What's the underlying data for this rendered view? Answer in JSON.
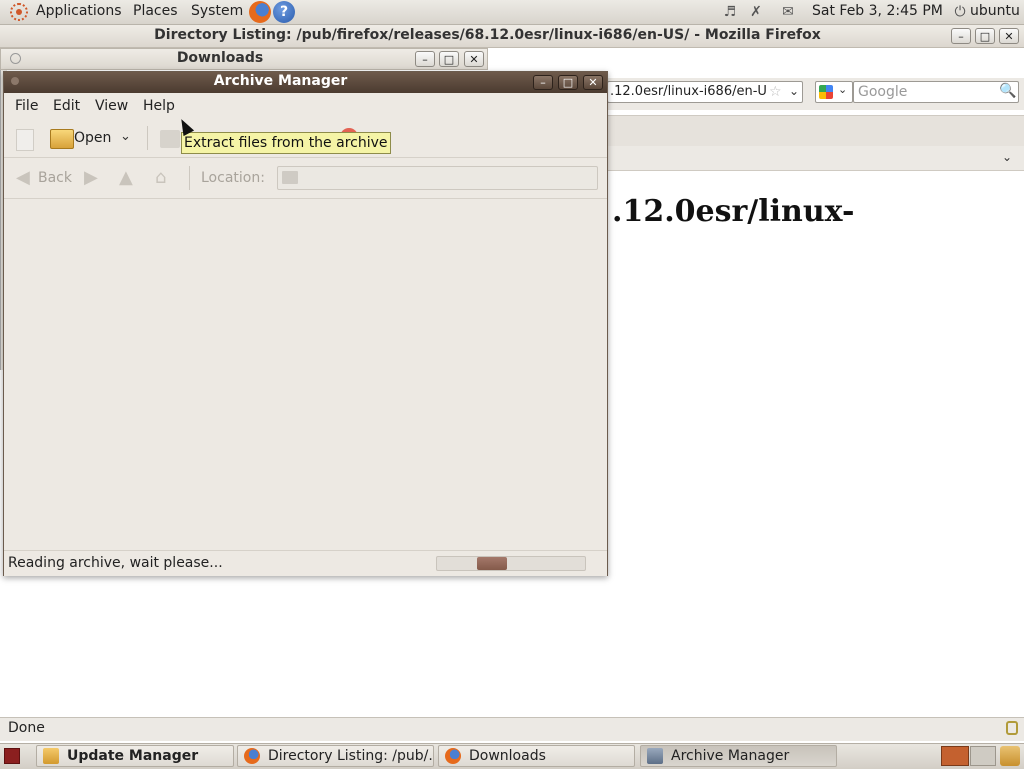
{
  "top_panel": {
    "applications": "Applications",
    "places": "Places",
    "system": "System",
    "datetime": "Sat Feb  3,  2:45 PM",
    "user": "ubuntu",
    "help_glyph": "?"
  },
  "firefox": {
    "title": "Directory Listing: /pub/firefox/releases/68.12.0esr/linux-i686/en-US/ - Mozilla Firefox",
    "url_visible": ".12.0esr/linux-i686/en-U",
    "search_placeholder": "Google",
    "heading_visible": ".12.0esr/linux-",
    "status": "Done"
  },
  "downloads": {
    "title": "Downloads"
  },
  "archive_manager": {
    "title": "Archive Manager",
    "menu": [
      "File",
      "Edit",
      "View",
      "Help"
    ],
    "toolbar": {
      "open_label": "Open"
    },
    "tooltip": "Extract files from the archive",
    "nav": {
      "back_label": "Back",
      "location_label": "Location:"
    },
    "status": "Reading archive, wait please...",
    "progress": {
      "indeterminate": true,
      "position_fraction": 0.27,
      "width_fraction": 0.2
    }
  },
  "taskbar": {
    "items": [
      {
        "label": "Update Manager",
        "bold": true
      },
      {
        "label": "Directory Listing: /pub/..."
      },
      {
        "label": "Downloads"
      },
      {
        "label": "Archive Manager",
        "active": true
      }
    ]
  },
  "icons": {
    "ubuntu_logo": "ubuntu-logo-icon",
    "firefox": "firefox-icon",
    "help": "help-icon",
    "volume": "volume-icon",
    "network": "network-icon",
    "mail": "mail-icon",
    "power": "power-icon"
  },
  "colors": {
    "am_titlebar": "#5a483b",
    "tooltip_bg": "#f5f4a6",
    "progress_fill": "#8f6555",
    "ubuntu_orange": "#d0582a"
  }
}
